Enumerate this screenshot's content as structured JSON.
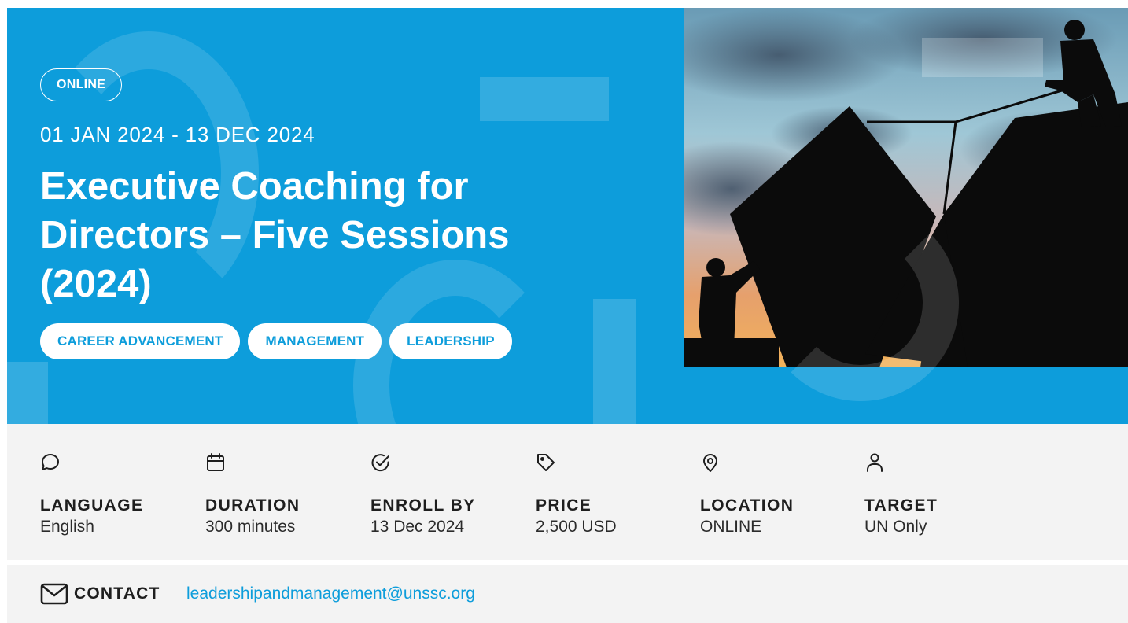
{
  "hero": {
    "badge": "ONLINE",
    "dates": "01 JAN 2024 - 13 DEC 2024",
    "title": "Executive Coaching for Directors – Five Sessions (2024)",
    "tags": [
      "CAREER ADVANCEMENT",
      "MANAGEMENT",
      "LEADERSHIP"
    ],
    "background_color": "#0d9ddb"
  },
  "facts": [
    {
      "icon": "speech-bubble-icon",
      "label": "LANGUAGE",
      "value": "English"
    },
    {
      "icon": "calendar-icon",
      "label": "DURATION",
      "value": "300 minutes"
    },
    {
      "icon": "check-circle-icon",
      "label": "ENROLL BY",
      "value": "13 Dec 2024"
    },
    {
      "icon": "price-tag-icon",
      "label": "PRICE",
      "value": "2,500 USD"
    },
    {
      "icon": "map-pin-icon",
      "label": "LOCATION",
      "value": "ONLINE"
    },
    {
      "icon": "person-icon",
      "label": "TARGET",
      "value": "UN Only"
    }
  ],
  "contact": {
    "icon": "mail-icon",
    "label": "CONTACT",
    "email": "leadershipandmanagement@unssc.org"
  },
  "colors": {
    "accent": "#0d9ddb",
    "panel": "#f3f3f3",
    "text": "#1e1e1e"
  }
}
